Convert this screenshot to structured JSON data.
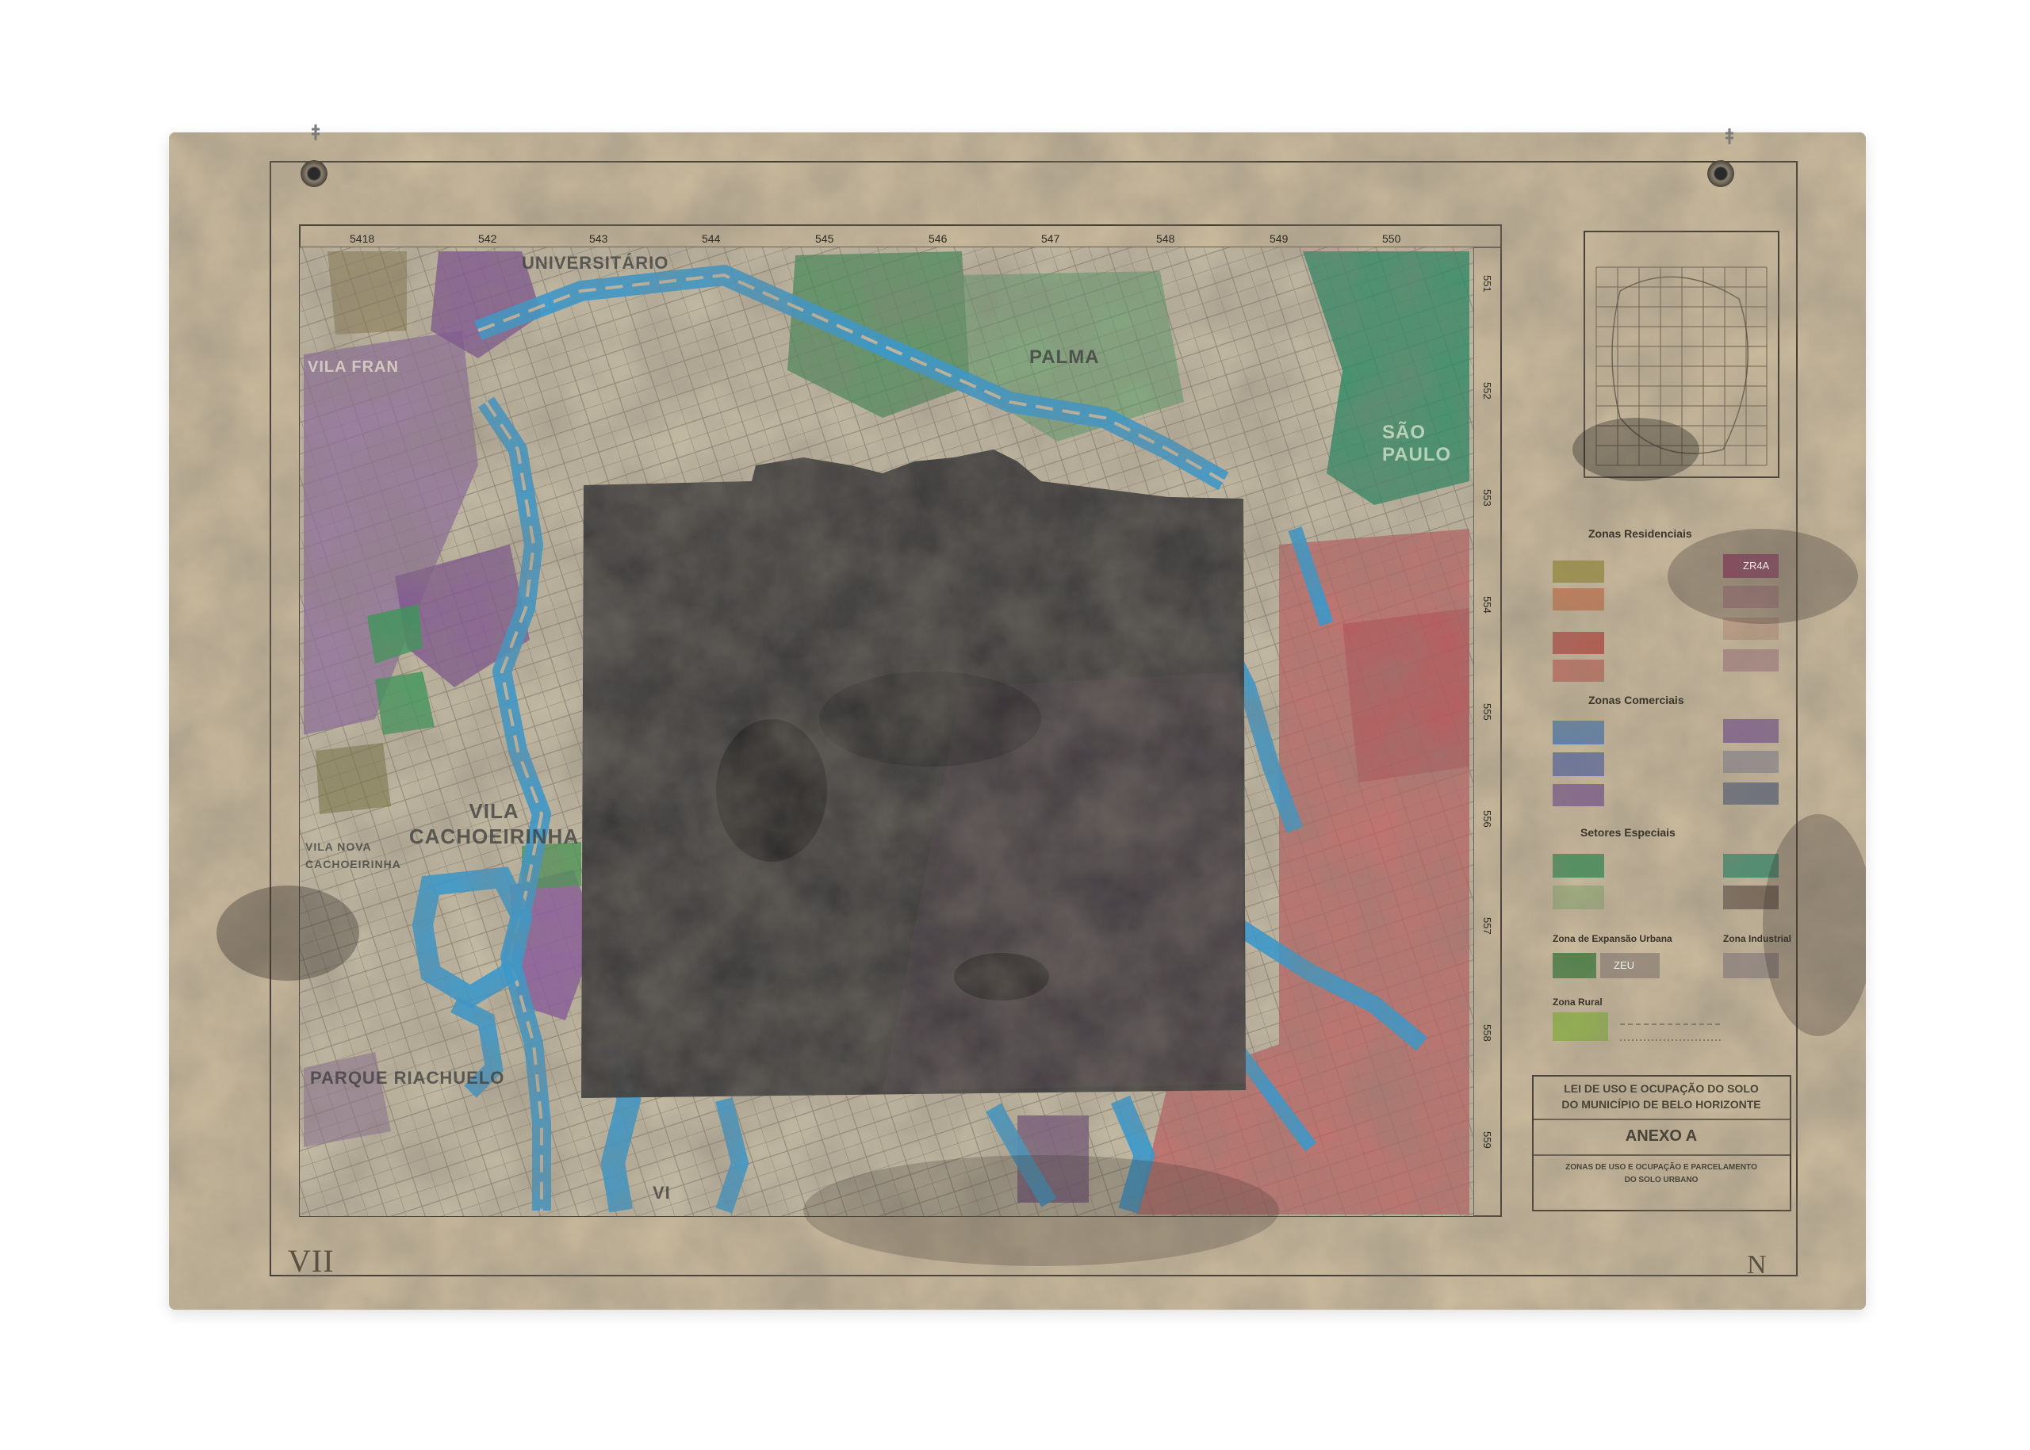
{
  "map": {
    "grid_top_labels": [
      "5418",
      "542",
      "543",
      "544",
      "545",
      "546",
      "547",
      "548",
      "549",
      "550"
    ],
    "grid_right_labels": [
      "551",
      "552",
      "553",
      "554",
      "555",
      "556",
      "557",
      "558",
      "559"
    ],
    "places": {
      "universitario": "UNIVERSITÁRIO",
      "vila_francisco": "VILA FRAN",
      "palmares": "PALMA",
      "sao_paulo": "SÃO PAULO",
      "vila_cachoeirinha": "VILA CACHOEIRINHA",
      "vila_nova_cachoeirinha": "VILA NOVA CACHOEIRINHA",
      "parque_riachuelo": "PARQUE RIACHUELO",
      "vila_bottom": "VI"
    },
    "sheet_number": "VII",
    "north_mark": "N"
  },
  "legend": {
    "zonas_residenciais": "Zonas Residenciais",
    "zonas_comerciais": "Zonas Comerciais",
    "setores_especiais": "Setores Especiais",
    "zona_expansao": "Zona de Expansão Urbana",
    "zona_industrial": "Zona Industrial",
    "zona_rural": "Zona Rural",
    "code_zr4a": "ZR4A",
    "code_zeu": "ZEU",
    "colors": {
      "residential_yellow": "#9b8f3e",
      "residential_orange": "#c9744a",
      "residential_red": "#b8453d",
      "commercial_blue": "#4a78b0",
      "commercial_purple": "#7b5a8f",
      "special_green": "#3a8a55",
      "expansion_green": "#3a7a3a",
      "rural_green": "#8ab83a",
      "zr4a_magenta": "#a83a70"
    }
  },
  "title_block": {
    "line1": "LEI DE USO E OCUPAÇÃO DO SOLO",
    "line2": "DO MUNICÍPIO DE BELO HORIZONTE",
    "annex": "ANEXO A",
    "line3": "ZONAS DE USO E OCUPAÇÃO E PARCELAMENTO",
    "line4": "DO SOLO URBANO"
  }
}
